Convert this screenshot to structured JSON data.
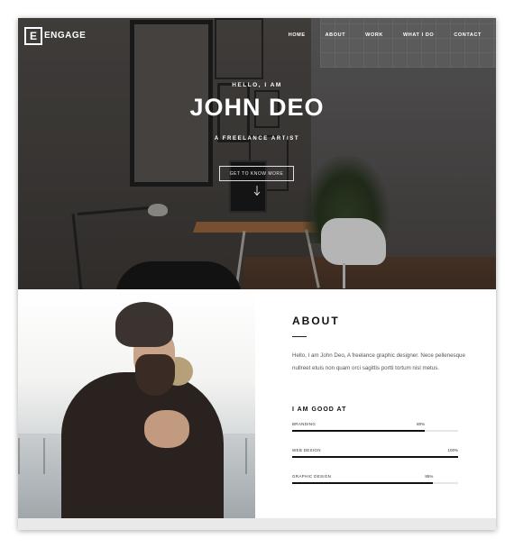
{
  "nav": {
    "logo_letter": "E",
    "logo_text": "ENGAGE",
    "items": [
      "HOME",
      "ABOUT",
      "WORK",
      "WHAT I DO",
      "CONTACT"
    ]
  },
  "hero": {
    "greeting": "HELLO, I AM",
    "name": "JOHN DEO",
    "tagline": "A FREELANCE ARTIST",
    "cta_label": "GET TO KNOW MORE"
  },
  "about": {
    "title": "ABOUT",
    "bio": "Hello, I am John Deo, A freelance graphic designer. Nece pellenesque nullreet etuis non quam orci sagittis portti tortum nisl metus.",
    "skills_title": "I AM GOOD AT",
    "skills": [
      {
        "label": "BRANDING",
        "percent_text": "80%",
        "level": 0.8
      },
      {
        "label": "WEB DESIGN",
        "percent_text": "100%",
        "level": 1.0
      },
      {
        "label": "GRAPHIC DESIGN",
        "percent_text": "85%",
        "level": 0.85
      }
    ]
  },
  "colors": {
    "accent": "#111111",
    "hero_overlay": "#3b3937"
  }
}
